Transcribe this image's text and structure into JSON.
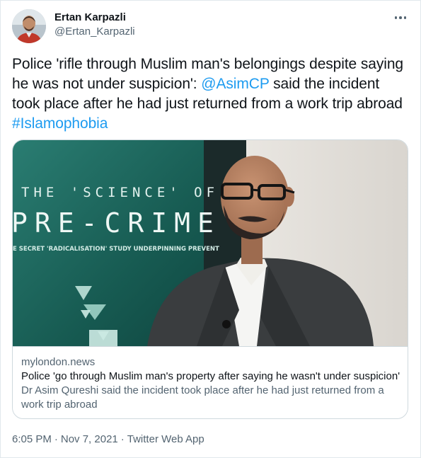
{
  "author": {
    "display_name": "Ertan Karpazli",
    "handle": "@Ertan_Karpazli",
    "avatar_icon": "user-avatar"
  },
  "tweet": {
    "text_part1": "Police 'rifle through Muslim man's belongings despite saying he was not under suspicion': ",
    "mention": "@AsimCP",
    "text_part2": " said the incident took place after he had just returned from a work trip abroad ",
    "hashtag": "#Islamophobia"
  },
  "card": {
    "image": {
      "headline_small": "THE 'SCIENCE' OF",
      "headline_large": "PRE-CRIME",
      "subline": "E SECRET 'RADICALISATION' STUDY UNDERPINNING PREVENT"
    },
    "domain": "mylondon.news",
    "title": "Police 'go through Muslim man's property after saying he wasn't under suspicion'",
    "description": "Dr Asim Qureshi said the incident took place after he had just returned from a work trip abroad"
  },
  "footer": {
    "time": "6:05 PM",
    "separator": "·",
    "date": "Nov 7, 2021",
    "separator2": "·",
    "source": "Twitter Web App"
  },
  "colors": {
    "link": "#1d9bf0",
    "text": "#0f1419",
    "muted": "#536471",
    "border": "#cfd9de",
    "teal_bg": "#1d6a60"
  }
}
